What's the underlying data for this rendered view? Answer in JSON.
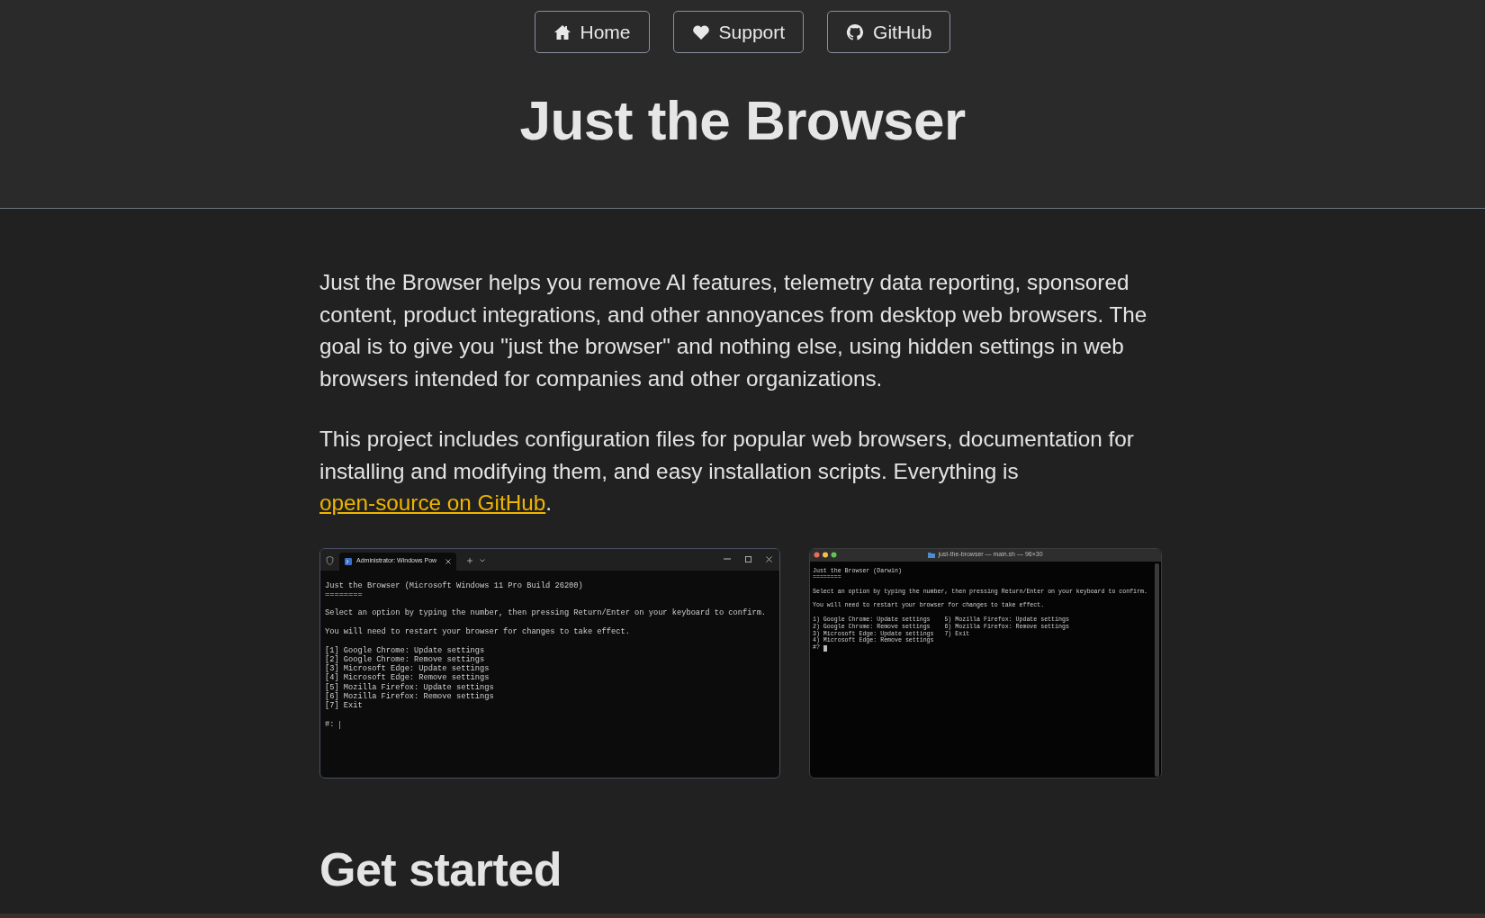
{
  "nav": {
    "buttons": [
      {
        "label": "Home"
      },
      {
        "label": "Support"
      },
      {
        "label": "GitHub"
      }
    ]
  },
  "title": "Just the Browser",
  "intro": [
    {
      "text": "Just the Browser helps you remove AI features, telemetry data reporting, sponsored content, product integrations, and other annoyances from desktop web browsers. The goal is to give you \"just the browser\" and nothing else, using hidden settings in web browsers intended for companies and other organizations."
    },
    {
      "text": "This project includes configuration files for popular web browsers, documentation for installing and modifying them, and easy installation scripts. Everything is ",
      "link": "open-source on GitHub",
      "after": "."
    }
  ],
  "screenshots": [
    {
      "kind": "windows",
      "tab_title": "Administrator: Windows Pow",
      "blocks": [
        [
          "Just the Browser (Microsoft Windows 11 Pro Build 26200)",
          "========"
        ],
        [
          "Select an option by typing the number, then pressing Return/Enter on your keyboard to confirm."
        ],
        [
          "You will need to restart your browser for changes to take effect."
        ],
        [
          "[1] Google Chrome: Update settings",
          "[2] Google Chrome: Remove settings",
          "[3] Microsoft Edge: Update settings",
          "[4] Microsoft Edge: Remove settings",
          "[5] Mozilla Firefox: Update settings",
          "[6] Mozilla Firefox: Remove settings",
          "[7] Exit"
        ]
      ],
      "prompt": "#:"
    },
    {
      "kind": "mac",
      "title": "just-the-browser — main.sh — 96×30",
      "blocks": [
        [
          "Just the Browser (Darwin)",
          "========"
        ],
        [
          "Select an option by typing the number, then pressing Return/Enter on your keyboard to confirm."
        ],
        [
          "You will need to restart your browser for changes to take effect."
        ],
        [
          "1) Google Chrome: Update settings    5) Mozilla Firefox: Update settings",
          "2) Google Chrome: Remove settings    6) Mozilla Firefox: Remove settings",
          "3) Microsoft Edge: Update settings   7) Exit",
          "4) Microsoft Edge: Remove settings"
        ]
      ],
      "prompt": "#?"
    }
  ],
  "section_heading": "Get started"
}
